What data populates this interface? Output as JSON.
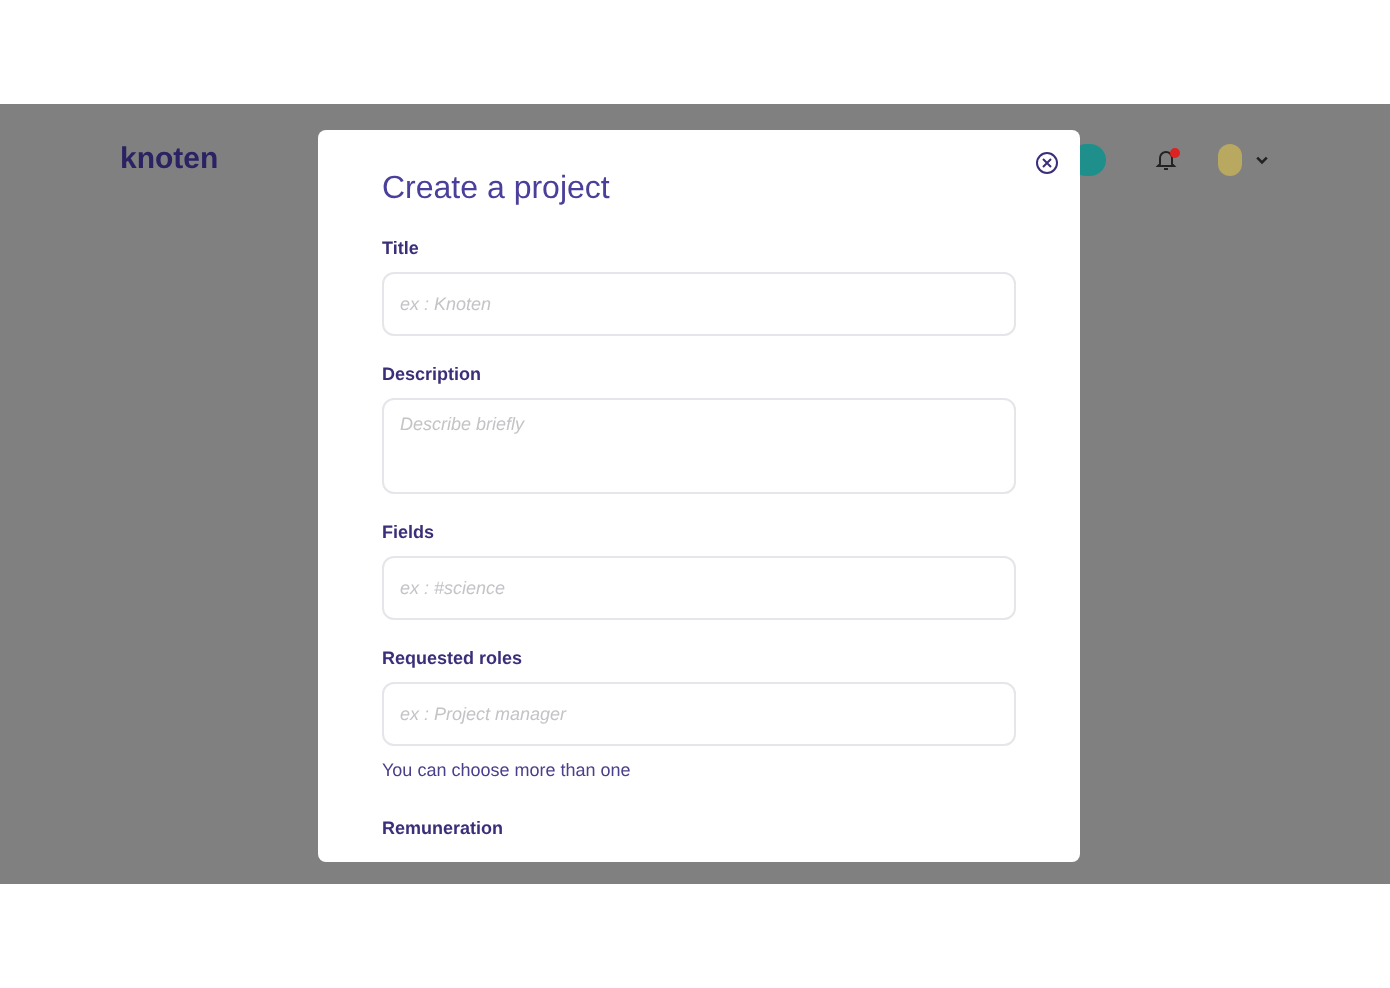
{
  "header": {
    "logo": "knoten",
    "notification_dot": true
  },
  "modal": {
    "title": "Create a project",
    "fields": [
      {
        "kind": "input",
        "label": "Title",
        "placeholder": "ex : Knoten"
      },
      {
        "kind": "textarea",
        "label": "Description",
        "placeholder": "Describe briefly"
      },
      {
        "kind": "input",
        "label": "Fields",
        "placeholder": "ex : #science"
      },
      {
        "kind": "input",
        "label": "Requested roles",
        "placeholder": "ex : Project manager",
        "helper": "You can choose more than one"
      },
      {
        "kind": "cut",
        "label": "Remuneration"
      }
    ]
  }
}
